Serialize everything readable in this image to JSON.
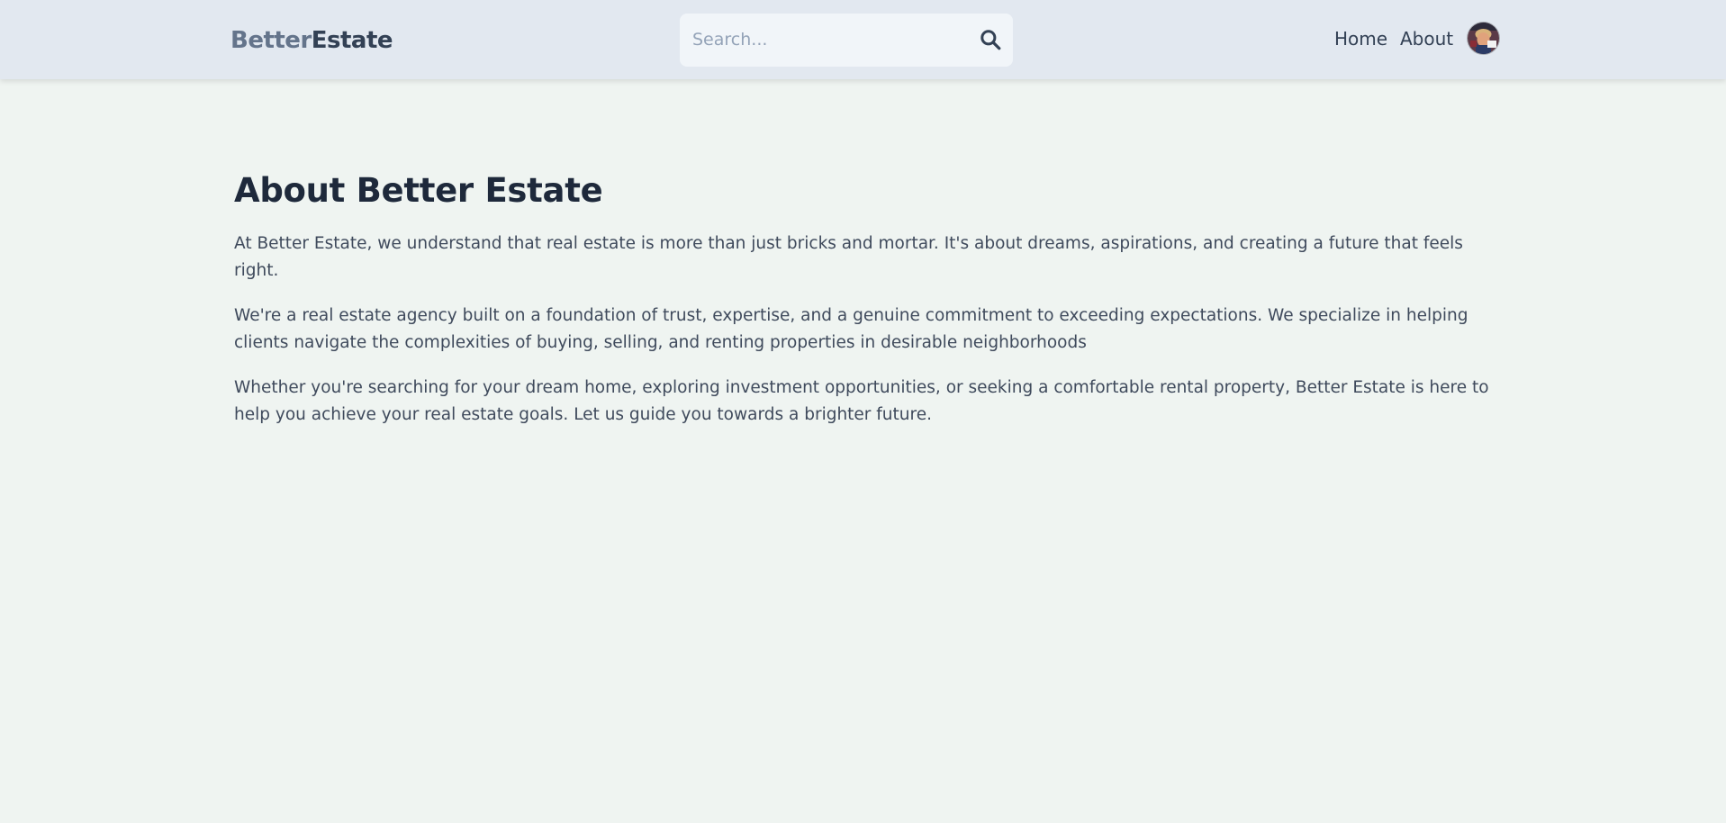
{
  "header": {
    "logo_part1": "Better",
    "logo_part2": "Estate",
    "search": {
      "placeholder": "Search..."
    },
    "nav": {
      "home": "Home",
      "about": "About"
    },
    "search_icon": "magnifier-icon",
    "avatar_icon": "user-avatar"
  },
  "main": {
    "title": "About Better Estate",
    "paragraphs": [
      "At Better Estate, we understand that real estate is more than just bricks and mortar. It's about dreams, aspirations, and creating a future that feels right.",
      "We're a real estate agency built on a foundation of trust, expertise, and a genuine commitment to exceeding expectations. We specialize in helping clients navigate the complexities of buying, selling, and renting properties in desirable neighborhoods",
      "Whether you're searching for your dream home, exploring investment opportunities, or seeking a comfortable rental property, Better Estate is here to help you achieve your real estate goals. Let us guide you towards a brighter future."
    ]
  },
  "colors": {
    "page_background": "#eff4f1",
    "header_background": "#e2e8f0",
    "logo_light": "#64748b",
    "logo_dark": "#334155",
    "heading": "#1e293b",
    "body_text": "#3f4a5c"
  }
}
